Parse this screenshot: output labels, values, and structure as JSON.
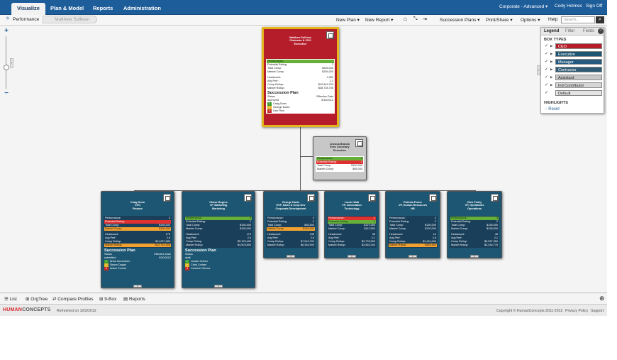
{
  "nav": {
    "tabs": [
      "Visualize",
      "Plan & Model",
      "Reports",
      "Administration"
    ],
    "right_links": [
      "Corporate - Advanced ▾",
      "Cody Holmes",
      "Sign Off"
    ]
  },
  "toolbar": {
    "performance": "Performance",
    "breadcrumb": "Matthew Sullivan",
    "new_plan": "New Plan ▾",
    "new_report": "New Report ▾",
    "succession_plans": "Succession Plans ▾",
    "print_share": "Print/Share ▾",
    "options": "Options ▾",
    "help": "Help",
    "search_placeholder": "Search..."
  },
  "legend": {
    "tabs": [
      "Legend",
      "Filter",
      "Fields"
    ],
    "box_types_title": "BOX TYPES",
    "items": [
      {
        "label": "CEO",
        "color": "#b51d2b",
        "text": "#ffffff",
        "expand": true
      },
      {
        "label": "Executive",
        "color": "#1d5672",
        "text": "#ffffff",
        "expand": true
      },
      {
        "label": "Manager",
        "color": "#245a80",
        "text": "#ffffff",
        "expand": true
      },
      {
        "label": "Contractor",
        "color": "#2e5a74",
        "text": "#ffffff",
        "expand": true
      },
      {
        "label": "Assistant",
        "color": "#c7c7c7",
        "text": "#222222",
        "expand": true
      },
      {
        "label": "Ind Contributor",
        "color": "#d6d6d6",
        "text": "#222222",
        "expand": true
      },
      {
        "label": "Default",
        "color": "#e4e4e4",
        "text": "#222222",
        "expand": false
      }
    ],
    "highlights_title": "HIGHLIGHTS",
    "reset": "Reset"
  },
  "ceo": {
    "name": "Matthew Sullivan",
    "title1": "Chairman & CEO",
    "title2": "Executive",
    "metrics": [
      {
        "label": "Performance:",
        "value": "",
        "style": "g"
      },
      {
        "label": "Potential Rating:",
        "value": "2",
        "style": ""
      },
      {
        "label": "Total Comp:",
        "value": "$235,000",
        "style": ""
      },
      {
        "label": "Market Comp:",
        "value": "$255,000",
        "style": ""
      }
    ],
    "metrics2": [
      {
        "label": "Headcount:",
        "value": "1,962",
        "style": ""
      },
      {
        "label": "Avg Perf:",
        "value": "2.1",
        "style": ""
      },
      {
        "label": "Comp Rollup:",
        "value": "$42,649,700",
        "style": ""
      },
      {
        "label": "Market Rollup:",
        "value": "$38,728,705",
        "style": ""
      }
    ],
    "succession": {
      "title": "Succession Plan",
      "status_label": "Status",
      "date_label": "Effective Date",
      "status": "approved",
      "date": "5/15/2012",
      "candidates": [
        {
          "n": "1",
          "c": "g",
          "name": "Craig Dunn"
        },
        {
          "n": "2",
          "c": "y",
          "name": "George Davis"
        },
        {
          "n": "3",
          "c": "r",
          "name": "Dan Flinn"
        }
      ]
    }
  },
  "assistant": {
    "name": "Jessica Brando",
    "title1": "Exec Secretary",
    "title2": "Executive",
    "metrics": [
      {
        "label": "Performance:",
        "value": "2",
        "style": "g"
      },
      {
        "label": "Potential Rating:",
        "value": "1",
        "style": "r"
      },
      {
        "label": "Total Comp:",
        "value": "$100,000",
        "style": ""
      },
      {
        "label": "Market Comp:",
        "value": "$65,000",
        "style": ""
      }
    ]
  },
  "executives": [
    {
      "name": "Craig Dunn",
      "title1": "CFO",
      "title2": "Finance",
      "metrics": [
        {
          "label": "Performance:",
          "value": "3",
          "style": ""
        },
        {
          "label": "Potential Rating:",
          "value": "",
          "style": "r"
        },
        {
          "label": "Total Comp:",
          "value": "$155,000",
          "style": ""
        },
        {
          "label": "Market Comp:",
          "value": "$160,000",
          "style": "o"
        }
      ],
      "metrics2": [
        {
          "label": "Headcount:",
          "value": "176",
          "style": ""
        },
        {
          "label": "Avg Perf:",
          "value": "2.6",
          "style": ""
        },
        {
          "label": "Comp Rollup:",
          "value": "$11,057,385",
          "style": ""
        },
        {
          "label": "Market Rollup:",
          "value": "$12,751,305",
          "style": "o"
        }
      ],
      "succession": {
        "title": "Succession Plan",
        "status_label": "Status",
        "date_label": "Effective Date",
        "status": "submitted",
        "date": "9/30/2012",
        "candidates": [
          {
            "n": "1",
            "c": "g",
            "name": "Brian Amundsen"
          },
          {
            "n": "2",
            "c": "y",
            "name": "Simon Dugan"
          },
          {
            "n": "3",
            "c": "r",
            "name": "Adam Conner"
          }
        ]
      }
    },
    {
      "name": "Chase Rogers",
      "title1": "VP, Marketing",
      "title2": "Marketing",
      "metrics": [
        {
          "label": "Performance:",
          "value": "3",
          "style": "g"
        },
        {
          "label": "Potential Rating:",
          "value": "2",
          "style": ""
        },
        {
          "label": "Total Comp:",
          "value": "$150,000",
          "style": ""
        },
        {
          "label": "Market Comp:",
          "value": "$155,000",
          "style": ""
        }
      ],
      "metrics2": [
        {
          "label": "Headcount:",
          "value": "170",
          "style": ""
        },
        {
          "label": "Avg Perf:",
          "value": "2.4",
          "style": ""
        },
        {
          "label": "Comp Rollup:",
          "value": "$5,123,400",
          "style": ""
        },
        {
          "label": "Market Rollup:",
          "value": "$4,503,800",
          "style": ""
        }
      ],
      "succession": {
        "title": "Succession Plan",
        "status_label": "Status",
        "date_label": "",
        "status": "draft",
        "date": "",
        "candidates": [
          {
            "n": "1",
            "c": "g",
            "name": "Jordan Hofner"
          },
          {
            "n": "2",
            "c": "y",
            "name": "Chris Cruiser"
          },
          {
            "n": "3",
            "c": "r",
            "name": "Caroline Grimes"
          }
        ]
      }
    },
    {
      "name": "George Davis",
      "title1": "EVP, Sales & Corp Dev",
      "title2": "Corporate Development",
      "metrics": [
        {
          "label": "Performance:",
          "value": "3",
          "style": ""
        },
        {
          "label": "Potential Rating:",
          "value": "2",
          "style": ""
        },
        {
          "label": "Total Comp:",
          "value": "$35,500",
          "style": ""
        },
        {
          "label": "Market Comp:",
          "value": "$145,000",
          "style": "o"
        }
      ],
      "metrics2": [
        {
          "label": "Headcount:",
          "value": "135",
          "style": ""
        },
        {
          "label": "Avg Perf:",
          "value": "2.6",
          "style": ""
        },
        {
          "label": "Comp Rollup:",
          "value": "$7,016,700",
          "style": ""
        },
        {
          "label": "Market Rollup:",
          "value": "$6,334,900",
          "style": ""
        }
      ]
    },
    {
      "name": "Laurie Wall",
      "title1": "VP, Information",
      "title2": "Technology",
      "metrics": [
        {
          "label": "Performance:",
          "value": "1",
          "style": "r"
        },
        {
          "label": "Potential Rating:",
          "value": "1",
          "style": "g"
        },
        {
          "label": "Total Comp:",
          "value": "$127,000",
          "style": ""
        },
        {
          "label": "Market Comp:",
          "value": "$112,500",
          "style": ""
        }
      ],
      "metrics2": [
        {
          "label": "Headcount:",
          "value": "38",
          "style": ""
        },
        {
          "label": "Avg Perf:",
          "value": "2.1",
          "style": ""
        },
        {
          "label": "Comp Rollup:",
          "value": "$2,703,500",
          "style": ""
        },
        {
          "label": "Market Rollup:",
          "value": "$2,563,200",
          "style": ""
        }
      ]
    },
    {
      "name": "Patricia Porter",
      "title1": "VP, Human Resources",
      "title2": "HR",
      "metrics": [
        {
          "label": "Performance:",
          "value": "2",
          "style": ""
        },
        {
          "label": "Potential Rating:",
          "value": "2",
          "style": ""
        },
        {
          "label": "Total Comp:",
          "value": "$130,000",
          "style": ""
        },
        {
          "label": "Market Comp:",
          "value": "$120,000",
          "style": ""
        }
      ],
      "metrics2": [
        {
          "label": "Headcount:",
          "value": "14",
          "style": ""
        },
        {
          "label": "Avg Perf:",
          "value": "2.6",
          "style": ""
        },
        {
          "label": "Comp Rollup:",
          "value": "$1,110,000",
          "style": ""
        },
        {
          "label": "Market Rollup:",
          "value": "$984,500",
          "style": "o"
        }
      ]
    },
    {
      "name": "Glen Finley",
      "title1": "VP, Operations",
      "title2": "Operations",
      "metrics": [
        {
          "label": "Performance:",
          "value": "3",
          "style": "g"
        },
        {
          "label": "Potential Rating:",
          "value": "2",
          "style": ""
        },
        {
          "label": "Total Comp:",
          "value": "$135,000",
          "style": ""
        },
        {
          "label": "Market Comp:",
          "value": "$138,500",
          "style": ""
        }
      ],
      "metrics2": [
        {
          "label": "Headcount:",
          "value": "48",
          "style": ""
        },
        {
          "label": "Avg Perf:",
          "value": "2.1",
          "style": ""
        },
        {
          "label": "Comp Rollup:",
          "value": "$3,537,350",
          "style": ""
        },
        {
          "label": "Market Rollup:",
          "value": "$3,434,775",
          "style": ""
        }
      ]
    }
  ],
  "bottom": {
    "list": "List",
    "orgtree": "OrgTree",
    "compare": "Compare Profiles",
    "ninebox": "9-Box",
    "reports": "Reports"
  },
  "footer": {
    "logo_a": "HUMAN",
    "logo_b": "CONCEPTS",
    "refreshed": "Refreshed on 10/3/2012",
    "copyright": "Copyright © HumanConcepts 2011-2012",
    "privacy": "Privacy Policy",
    "support": "Support"
  }
}
